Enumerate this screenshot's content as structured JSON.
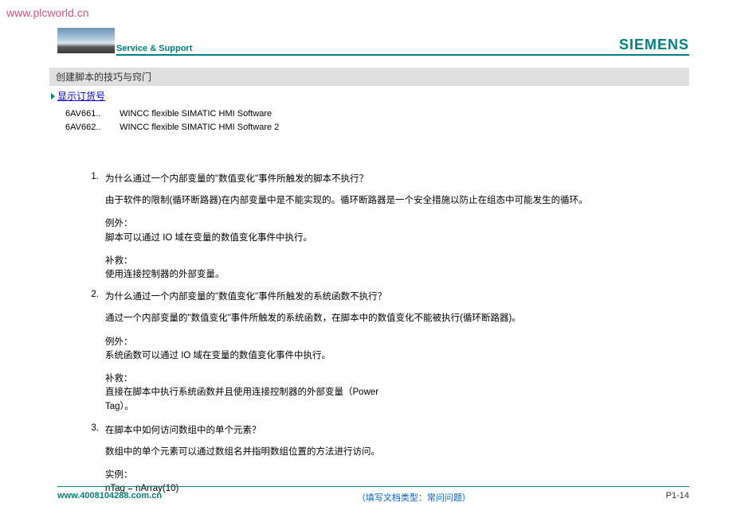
{
  "watermark": "www.plcworld.cn",
  "header": {
    "service_support": "Service & Support",
    "siemens": "SIEMENS"
  },
  "title": "创建脚本的技巧与窍门",
  "order_link": "显示订货号",
  "products": [
    {
      "code": "6AV661..",
      "name": "WINCC flexible SIMATIC HMI Software"
    },
    {
      "code": "6AV662..",
      "name": "WINCC flexible SIMATIC HMI Software 2"
    }
  ],
  "qa": [
    {
      "num": "1.",
      "question": "为什么通过一个内部变量的\"数值变化\"事件所触发的脚本不执行？",
      "answer": "由于软件的限制(循环断路器)在内部变量中是不能实现的。循环断路器是一个安全措施以防止在组态中可能发生的循环。",
      "exception_label": "例外：",
      "exception": "脚本可以通过 IO 域在变量的数值变化事件中执行。",
      "supplement_label": "补救：",
      "supplement": "使用连接控制器的外部变量。"
    },
    {
      "num": "2.",
      "question": "为什么通过一个内部变量的\"数值变化\"事件所触发的系统函数不执行？",
      "answer": "通过一个内部变量的\"数值变化\"事件所触发的系统函数，在脚本中的数值变化不能被执行(循环断路器)。",
      "exception_label": "例外：",
      "exception": "系统函数可以通过 IO 域在变量的数值变化事件中执行。",
      "supplement_label": "补救：",
      "supplement": "直接在脚本中执行系统函数并且使用连接控制器的外部变量（Power",
      "supplement2": "Tag）。"
    },
    {
      "num": "3.",
      "question": "在脚本中如何访问数组中的单个元素？",
      "answer": "数组中的单个元素可以通过数组名并指明数组位置的方法进行访问。",
      "example_label": "实例：",
      "example": "nTag = nArray(10)"
    }
  ],
  "footer": {
    "left": "www.4008104288.com.cn",
    "center": "（填写文档类型：常问问题）",
    "right": "P1-14"
  }
}
